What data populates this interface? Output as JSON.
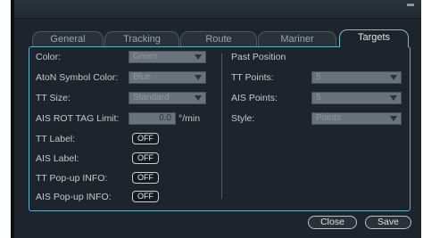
{
  "tabs": [
    "General",
    "Tracking",
    "Route",
    "Mariner",
    "Targets"
  ],
  "left": {
    "color_label": "Color:",
    "color_value": "Green",
    "aton_label": "AtoN Symbol Color:",
    "aton_value": "Blue",
    "tt_size_label": "TT Size:",
    "tt_size_value": "Standard",
    "ais_rot_label": "AIS ROT TAG Limit:",
    "ais_rot_value": "0.0",
    "ais_rot_unit": "°/min",
    "tt_label_label": "TT Label:",
    "tt_label_value": "OFF",
    "ais_label_label": "AIS Label:",
    "ais_label_value": "OFF",
    "tt_popup_label": "TT Pop-up INFO:",
    "tt_popup_value": "OFF",
    "ais_popup_label": "AIS Pop-up INFO:",
    "ais_popup_value": "OFF"
  },
  "right": {
    "heading": "Past Position",
    "tt_points_label": "TT Points:",
    "tt_points_value": "5",
    "ais_points_label": "AIS Points:",
    "ais_points_value": "5",
    "style_label": "Style:",
    "style_value": "Points"
  },
  "buttons": {
    "close": "Close",
    "save": "Save"
  },
  "colors": {
    "accent": "#5cb2c4",
    "background": "#1d242b",
    "combo": "#69737b"
  }
}
